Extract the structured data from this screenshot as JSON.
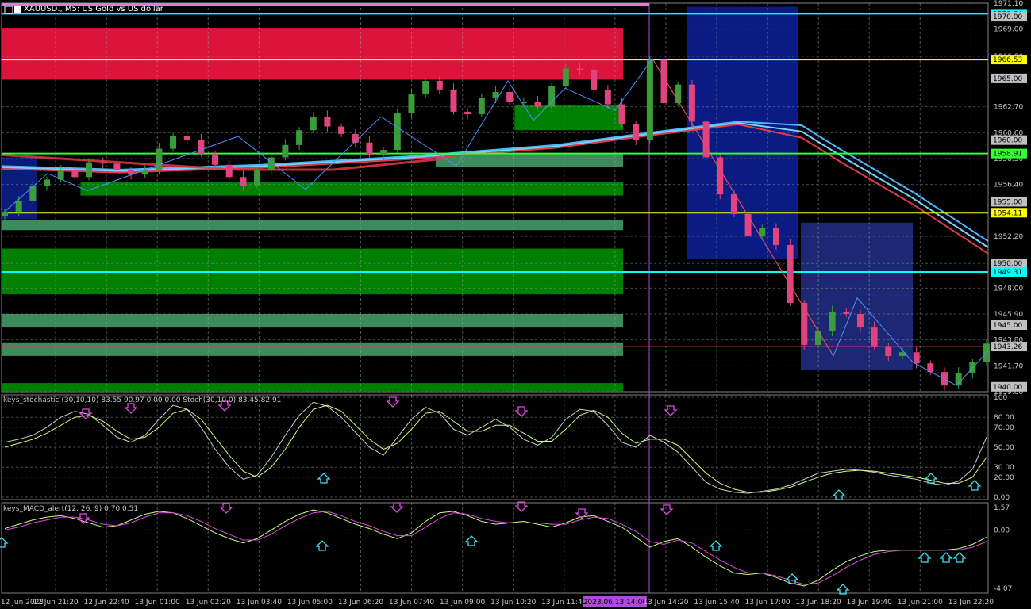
{
  "window": {
    "symbol_title": "XAUUSD., M5:  US Gold vs US dollar"
  },
  "stochastic_panel": {
    "title": "keys_stochastic (30,10,10) 83.55 90.97 0.00 0.00 Stoch(30,10,0) 83.45 82.91",
    "levels": [
      "100",
      "80.00",
      "70.00",
      "50.00",
      "30.00",
      "20.00",
      "0.00"
    ]
  },
  "macd_panel": {
    "title": "keys_MACD_alert(12, 26, 9) 0.70 0.51",
    "levels": [
      "1.57",
      "0.00",
      "-4.07"
    ]
  },
  "colors": {
    "background": "#000000",
    "bull": "#3a9d3a",
    "bear": "#e0437e",
    "supply_zone": "#dc143c",
    "demand_zone": "#008000",
    "demand_zone_light": "#3d8b5a",
    "session_box": "#0b1e8a",
    "session_box_2": "#1f2a7a",
    "yellow_line": "#ffff00",
    "green_line": "#33ff33",
    "cyan_line": "#00ffff",
    "ma_blue": "#4db8ff",
    "ma_red": "#e23a4a"
  },
  "chart_data": [
    {
      "type": "candlestick",
      "title": "XAUUSD., M5:  US Gold vs US dollar",
      "x_tick_labels": [
        "12 Jun 2023",
        "12 Jun 21:20",
        "12 Jun 22:40",
        "13 Jun 01:00",
        "13 Jun 02:20",
        "13 Jun 03:40",
        "13 Jun 05:00",
        "13 Jun 06:20",
        "13 Jun 07:40",
        "13 Jun 09:00",
        "13 Jun 10:20",
        "13 Jun 11:40",
        "2023.06.13 14:00",
        "13 Jun 14:20",
        "13 Jun 15:40",
        "13 Jun 17:00",
        "13 Jun 18:20",
        "13 Jun 19:40",
        "13 Jun 21:00",
        "13 Jun 22:20"
      ],
      "y_tick_labels": [
        "1971.10",
        "1969.00",
        "1966.80",
        "1962.70",
        "1960.60",
        "1958.50",
        "1956.40",
        "1952.20",
        "1950.00",
        "1948.00",
        "1945.90",
        "1943.80",
        "1941.70",
        "1939.60"
      ],
      "ylim": [
        1939.6,
        1971.1
      ],
      "price_labels": [
        {
          "text": "1970.24",
          "value": 1970.24,
          "color": "#00ffff"
        },
        {
          "text": "1970.00",
          "value": 1970.0,
          "color": "#c0c0c0"
        },
        {
          "text": "1966.53",
          "value": 1966.53,
          "color": "#ffff00"
        },
        {
          "text": "1965.00",
          "value": 1965.0,
          "color": "#c0c0c0"
        },
        {
          "text": "1960.00",
          "value": 1960.0,
          "color": "#c0c0c0"
        },
        {
          "text": "1958.91",
          "value": 1958.91,
          "color": "#33ff33"
        },
        {
          "text": "1955.00",
          "value": 1955.0,
          "color": "#c0c0c0"
        },
        {
          "text": "1954.11",
          "value": 1954.11,
          "color": "#ffff00"
        },
        {
          "text": "1950.00",
          "value": 1950.0,
          "color": "#c0c0c0"
        },
        {
          "text": "1949.31",
          "value": 1949.31,
          "color": "#00ffff"
        },
        {
          "text": "1945.00",
          "value": 1945.0,
          "color": "#c0c0c0"
        },
        {
          "text": "1943.26",
          "value": 1943.26,
          "color": "#c0c0c0"
        },
        {
          "text": "1940.00",
          "value": 1940.0,
          "color": "#c0c0c0"
        }
      ],
      "horizontal_lines": [
        {
          "value": 1970.24,
          "color": "#00ffff"
        },
        {
          "value": 1966.53,
          "color": "#ffff00"
        },
        {
          "value": 1958.91,
          "color": "#33ff33"
        },
        {
          "value": 1954.11,
          "color": "#ffff00"
        },
        {
          "value": 1949.31,
          "color": "#00ffff"
        },
        {
          "value": 1943.26,
          "color": "#e23a4a"
        }
      ],
      "zones": [
        {
          "kind": "supply",
          "from_price": 1964.9,
          "to_price": 1969.1,
          "x_from": 0.0,
          "x_to": 0.63
        },
        {
          "kind": "demand",
          "from_price": 1960.8,
          "to_price": 1962.8,
          "x_from": 0.52,
          "x_to": 0.63
        },
        {
          "kind": "demand_light",
          "from_price": 1957.8,
          "to_price": 1958.9,
          "x_from": 0.44,
          "x_to": 0.63
        },
        {
          "kind": "demand",
          "from_price": 1955.5,
          "to_price": 1956.6,
          "x_from": 0.08,
          "x_to": 0.63
        },
        {
          "kind": "demand_light",
          "from_price": 1952.7,
          "to_price": 1953.5,
          "x_from": 0.0,
          "x_to": 0.63
        },
        {
          "kind": "demand",
          "from_price": 1947.5,
          "to_price": 1951.2,
          "x_from": 0.0,
          "x_to": 0.63
        },
        {
          "kind": "demand_light",
          "from_price": 1944.8,
          "to_price": 1945.9,
          "x_from": 0.0,
          "x_to": 0.63
        },
        {
          "kind": "demand_light",
          "from_price": 1942.5,
          "to_price": 1943.6,
          "x_from": 0.0,
          "x_to": 0.63
        },
        {
          "kind": "demand",
          "from_price": 1939.6,
          "to_price": 1940.3,
          "x_from": 0.0,
          "x_to": 0.63
        }
      ],
      "series": [
        {
          "name": "",
          "close": [
            1954.2,
            1955.1,
            1956.3,
            1956.8,
            1957.6,
            1957.0,
            1958.2,
            1958.1,
            1957.6,
            1957.2,
            1957.6,
            1959.3,
            1960.3,
            1960.0,
            1958.9,
            1958.0,
            1957.0,
            1956.3,
            1957.6,
            1958.6,
            1959.6,
            1960.8,
            1961.9,
            1961.1,
            1960.5,
            1959.8,
            1958.8,
            1959.2,
            1962.2,
            1963.7,
            1964.8,
            1964.1,
            1962.3,
            1962.1,
            1963.4,
            1963.9,
            1963.1,
            1963.1,
            1962.7,
            1964.4,
            1965.8,
            1965.7,
            1964.1,
            1962.9,
            1961.3,
            1960.0,
            1966.5,
            1963.0,
            1964.5,
            1961.5,
            1958.6,
            1955.6,
            1954.0,
            1952.2,
            1952.9,
            1951.5,
            1946.8,
            1943.4,
            1944.5,
            1946.1,
            1945.9,
            1944.8,
            1943.3,
            1942.5,
            1942.8,
            1941.9,
            1941.2,
            1940.1,
            1941.1,
            1942.0,
            1943.5
          ]
        }
      ]
    },
    {
      "type": "line",
      "title": "keys_stochastic (30,10,10) 83.55 90.97 0.00 0.00 Stoch(30,10,0) 83.45 82.91",
      "ylim": [
        0,
        100
      ],
      "series": [
        {
          "name": "",
          "values": [
            55,
            58,
            62,
            70,
            80,
            86,
            83,
            72,
            60,
            55,
            62,
            78,
            92,
            88,
            70,
            48,
            30,
            18,
            22,
            40,
            62,
            82,
            95,
            91,
            80,
            65,
            50,
            42,
            60,
            78,
            90,
            84,
            68,
            62,
            70,
            78,
            70,
            58,
            52,
            60,
            78,
            88,
            86,
            72,
            55,
            50,
            62,
            55,
            45,
            30,
            15,
            8,
            5,
            4,
            6,
            8,
            12,
            18,
            24,
            26,
            28,
            27,
            25,
            22,
            20,
            18,
            14,
            12,
            16,
            28,
            60
          ]
        },
        {
          "name": "",
          "values": [
            50,
            54,
            58,
            64,
            72,
            80,
            82,
            76,
            66,
            58,
            60,
            70,
            84,
            88,
            78,
            60,
            42,
            26,
            20,
            30,
            48,
            70,
            88,
            92,
            86,
            72,
            58,
            48,
            54,
            68,
            84,
            86,
            76,
            66,
            66,
            72,
            72,
            64,
            56,
            56,
            68,
            82,
            87,
            80,
            64,
            54,
            58,
            58,
            52,
            38,
            24,
            14,
            8,
            5,
            5,
            7,
            10,
            15,
            20,
            24,
            26,
            27,
            26,
            24,
            22,
            20,
            17,
            14,
            14,
            20,
            40
          ]
        }
      ]
    },
    {
      "type": "line",
      "title": "keys_MACD_alert(12, 26, 9) 0.70 0.51",
      "ylim": [
        -4.07,
        1.57
      ],
      "series": [
        {
          "name": "",
          "values": [
            0.1,
            0.4,
            0.7,
            0.9,
            1.0,
            0.8,
            0.5,
            0.2,
            0.3,
            0.7,
            1.1,
            1.3,
            1.2,
            0.8,
            0.3,
            -0.2,
            -0.6,
            -0.9,
            -0.6,
            0.0,
            0.6,
            1.1,
            1.4,
            1.2,
            0.8,
            0.4,
            0.1,
            -0.3,
            -0.6,
            -0.2,
            0.6,
            1.2,
            1.3,
            1.0,
            0.6,
            0.4,
            0.5,
            0.6,
            0.4,
            0.2,
            0.5,
            0.9,
            1.0,
            0.6,
            0.2,
            -0.5,
            -1.2,
            -0.8,
            -0.6,
            -1.2,
            -1.9,
            -2.5,
            -3.0,
            -3.1,
            -3.0,
            -3.3,
            -3.7,
            -3.9,
            -3.5,
            -2.8,
            -2.2,
            -1.8,
            -1.5,
            -1.4,
            -1.4,
            -1.4,
            -1.4,
            -1.4,
            -1.3,
            -1.0,
            -0.5
          ]
        },
        {
          "name": "",
          "values": [
            0.0,
            0.2,
            0.5,
            0.7,
            0.9,
            0.9,
            0.7,
            0.4,
            0.3,
            0.5,
            0.9,
            1.2,
            1.2,
            1.0,
            0.6,
            0.1,
            -0.3,
            -0.7,
            -0.7,
            -0.3,
            0.3,
            0.8,
            1.2,
            1.3,
            1.0,
            0.6,
            0.3,
            -0.1,
            -0.4,
            -0.4,
            0.2,
            0.8,
            1.2,
            1.1,
            0.8,
            0.6,
            0.5,
            0.5,
            0.5,
            0.4,
            0.4,
            0.7,
            0.9,
            0.8,
            0.4,
            -0.1,
            -0.8,
            -1.0,
            -0.7,
            -0.9,
            -1.5,
            -2.1,
            -2.6,
            -3.0,
            -3.0,
            -3.2,
            -3.5,
            -3.8,
            -3.7,
            -3.2,
            -2.6,
            -2.1,
            -1.7,
            -1.5,
            -1.4,
            -1.4,
            -1.4,
            -1.4,
            -1.4,
            -1.2,
            -0.8
          ]
        }
      ]
    }
  ]
}
